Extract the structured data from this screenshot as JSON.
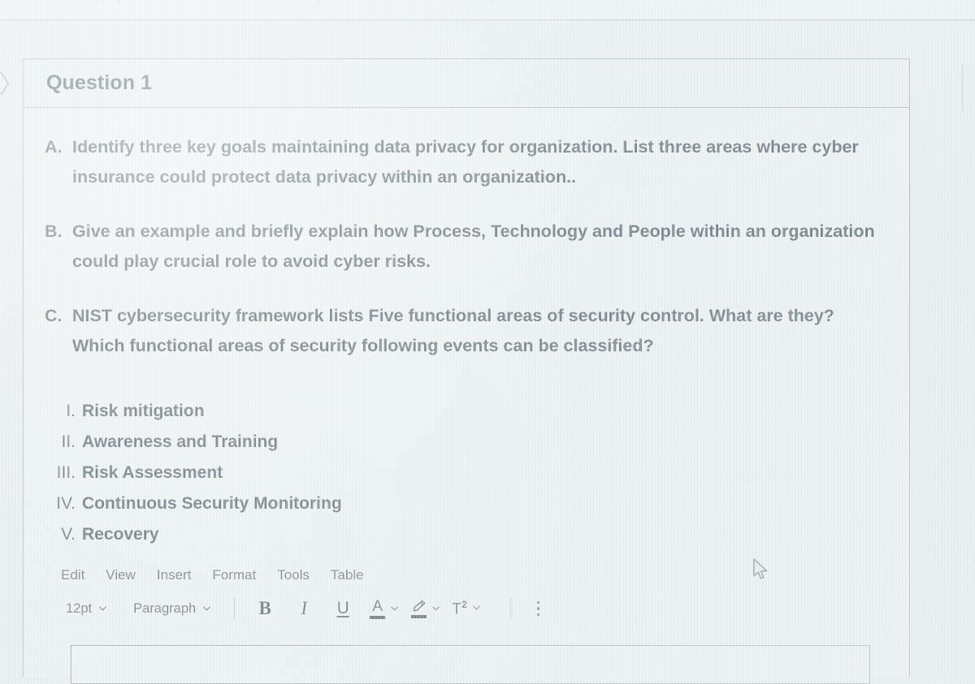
{
  "window": {
    "top_strip_ghost_text": "",
    "question_title": "Question 1"
  },
  "prompts": [
    {
      "label": "A.",
      "text": "Identify three key goals maintaining data privacy for organization. List three areas where cyber insurance could protect data privacy within an organization.."
    },
    {
      "label": "B.",
      "text": "Give an example and briefly explain how Process, Technology and People within an organization could play crucial role to avoid cyber risks."
    },
    {
      "label": "C.",
      "text": "NIST cybersecurity framework lists Five functional areas of security control. What are they? Which functional areas of security following events can be classified?"
    }
  ],
  "roman_list": [
    {
      "numeral": "I.",
      "text": "Risk mitigation"
    },
    {
      "numeral": "II.",
      "text": "Awareness and Training"
    },
    {
      "numeral": "III.",
      "text": "Risk Assessment"
    },
    {
      "numeral": "IV.",
      "text": "Continuous Security Monitoring"
    },
    {
      "numeral": "V.",
      "text": "Recovery"
    }
  ],
  "editor": {
    "menu": [
      {
        "label": "Edit"
      },
      {
        "label": "View"
      },
      {
        "label": "Insert"
      },
      {
        "label": "Format"
      },
      {
        "label": "Tools"
      },
      {
        "label": "Table"
      }
    ],
    "font_size": "12pt",
    "block_format": "Paragraph",
    "bold_label": "B",
    "italic_label": "I",
    "underline_label": "U",
    "text_color_label": "A",
    "superscript_label": "T",
    "superscript_exp": "2",
    "input_value": "",
    "input_placeholder": ""
  },
  "colors": {
    "page_background": "#e9edee",
    "card_background": "#eef2f3",
    "card_border": "#9aa9ad",
    "text_primary": "#3b4a53",
    "text_title": "#2f3f47",
    "toolbar_text": "#4f5c64"
  }
}
